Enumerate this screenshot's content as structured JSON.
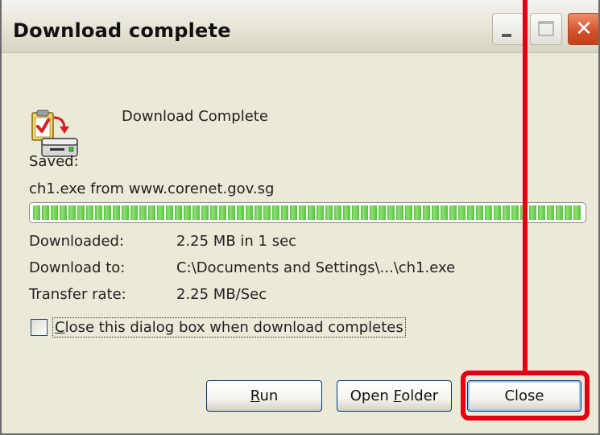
{
  "window": {
    "title": "Download complete"
  },
  "titlebar_buttons": {
    "minimize_icon": "minimize-icon",
    "maximize_icon": "maximize-icon",
    "close_icon": "close-icon",
    "close_glyph": "✕"
  },
  "header": {
    "icon": "download-complete-icon",
    "message": "Download Complete"
  },
  "saved": {
    "label": "Saved:",
    "file_line": "ch1.exe from www.corenet.gov.sg"
  },
  "progress": {
    "fraction": 1.0
  },
  "details": {
    "downloaded_label": "Downloaded:",
    "downloaded_value": "2.25 MB in 1 sec",
    "download_to_label": "Download to:",
    "download_to_value": "C:\\Documents and Settings\\...\\ch1.exe",
    "transfer_rate_label": "Transfer rate:",
    "transfer_rate_value": "2.25 MB/Sec"
  },
  "option": {
    "checkbox_checked": false,
    "label_first": "C",
    "label_rest": "lose this dialog box when download completes"
  },
  "buttons": {
    "run_first": "R",
    "run_rest": "un",
    "open_folder_prefix": "Open ",
    "open_folder_first": "F",
    "open_folder_rest": "older",
    "close_label": "Close"
  },
  "colors": {
    "highlight": "#e30013",
    "progress_green": "#53c53a",
    "dialog_bg": "#ece9d8"
  }
}
